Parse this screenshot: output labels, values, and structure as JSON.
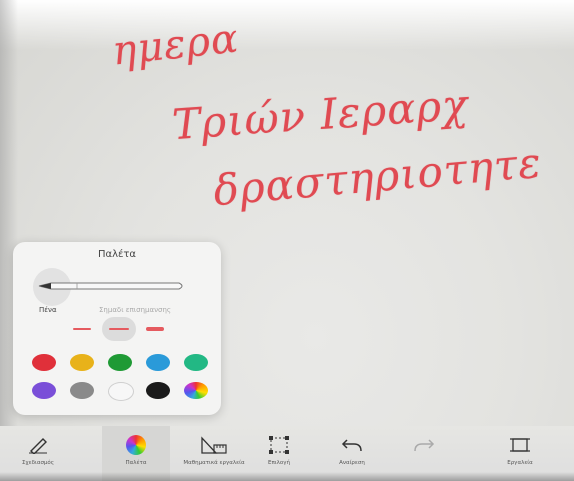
{
  "canvas": {
    "ink_color": "#e04a52",
    "handwriting": [
      "ημερα",
      "Τριών Ιεραρχ",
      "δραστηριοτητε"
    ]
  },
  "palette": {
    "title": "Παλέτα",
    "pen_label": "Πένα",
    "highlighter_label": "Σημαδι επισημανσης",
    "stroke_widths": [
      "thin",
      "medium",
      "thick"
    ],
    "selected_stroke": "medium",
    "colors": [
      {
        "name": "red",
        "hex": "#e0303a"
      },
      {
        "name": "yellow",
        "hex": "#e8b21a"
      },
      {
        "name": "green",
        "hex": "#1f9a35"
      },
      {
        "name": "blue",
        "hex": "#2a9ad9"
      },
      {
        "name": "teal",
        "hex": "#22b884"
      },
      {
        "name": "purple",
        "hex": "#7a4fd8"
      },
      {
        "name": "gray",
        "hex": "#8a8a8a"
      },
      {
        "name": "white",
        "hex": "#f7f7f7"
      },
      {
        "name": "black",
        "hex": "#1a1a1a"
      },
      {
        "name": "custom-color",
        "hex": "rainbow"
      }
    ]
  },
  "toolbar": {
    "tools": [
      {
        "label": "Σχεδιασμός",
        "icon": "pen-icon",
        "active": false
      },
      {
        "label": "Παλέτα",
        "icon": "color-wheel-icon",
        "active": true
      },
      {
        "label": "Μαθηματικά εργαλεία",
        "icon": "math-tools-icon",
        "active": false
      },
      {
        "label": "Επιλογή",
        "icon": "selection-icon",
        "active": false
      },
      {
        "label": "Αναίρεση",
        "icon": "undo-icon",
        "active": false
      },
      {
        "label": "",
        "icon": "redo-icon",
        "active": false
      },
      {
        "label": "Εργαλεία",
        "icon": "tools-icon",
        "active": false
      }
    ]
  }
}
